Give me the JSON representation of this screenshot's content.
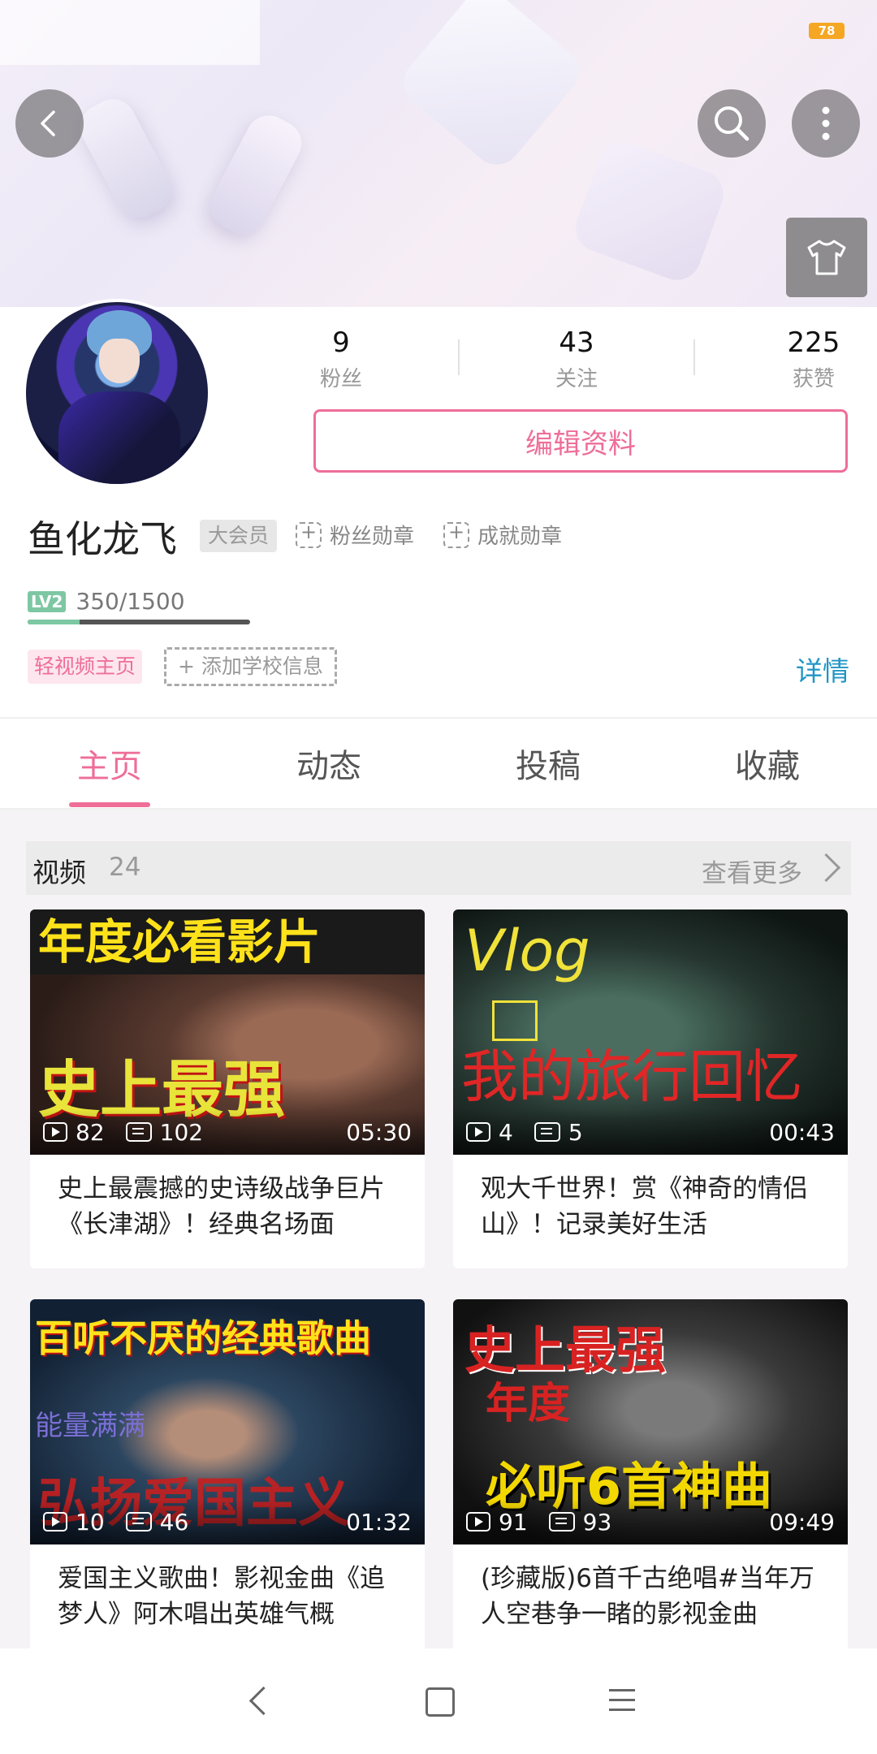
{
  "status": {
    "battery": "78"
  },
  "profile": {
    "followers_count": "9",
    "followers_label": "粉丝",
    "following_count": "43",
    "following_label": "关注",
    "likes_count": "225",
    "likes_label": "获赞",
    "edit_button": "编辑资料",
    "username": "鱼化龙飞",
    "vip_badge": "大会员",
    "fan_medal": "粉丝勋章",
    "achievement_medal": "成就勋章",
    "level_badge": "LV2",
    "exp": "350/1500",
    "exp_progress": 0.233,
    "tag_light_video": "轻视频主页",
    "add_school": "+ 添加学校信息",
    "details_link": "详情"
  },
  "tabs": [
    "主页",
    "动态",
    "投稿",
    "收藏"
  ],
  "videos": {
    "section_title": "视频",
    "count": "24",
    "more": "查看更多",
    "items": [
      {
        "thumb_line1": "年度必看影片",
        "thumb_line2": "史上最强",
        "plays": "82",
        "comments": "102",
        "duration": "05:30",
        "title": "史上最震撼的史诗级战争巨片《长津湖》！经典名场面"
      },
      {
        "thumb_line1": "Vlog",
        "thumb_line2": "我的旅行回忆",
        "plays": "4",
        "comments": "5",
        "duration": "00:43",
        "title": "观大千世界！赏《神奇的情侣山》！记录美好生活"
      },
      {
        "thumb_line1": "百听不厌的经典歌曲",
        "thumb_line2": "能量满满",
        "thumb_line3": "弘扬爱国主义",
        "plays": "10",
        "comments": "46",
        "duration": "01:32",
        "title": "爱国主义歌曲！影视金曲《追梦人》阿木唱出英雄气概"
      },
      {
        "thumb_line1": "史上最强",
        "thumb_line2": "年度",
        "thumb_line3": "必听6首神曲",
        "plays": "91",
        "comments": "93",
        "duration": "09:49",
        "title": "(珍藏版)6首千古绝唱#当年万人空巷争一睹的影视金曲"
      }
    ]
  },
  "colors": {
    "accent": "#ee6e98",
    "link": "#2196c6",
    "level": "#7ec7a3"
  }
}
